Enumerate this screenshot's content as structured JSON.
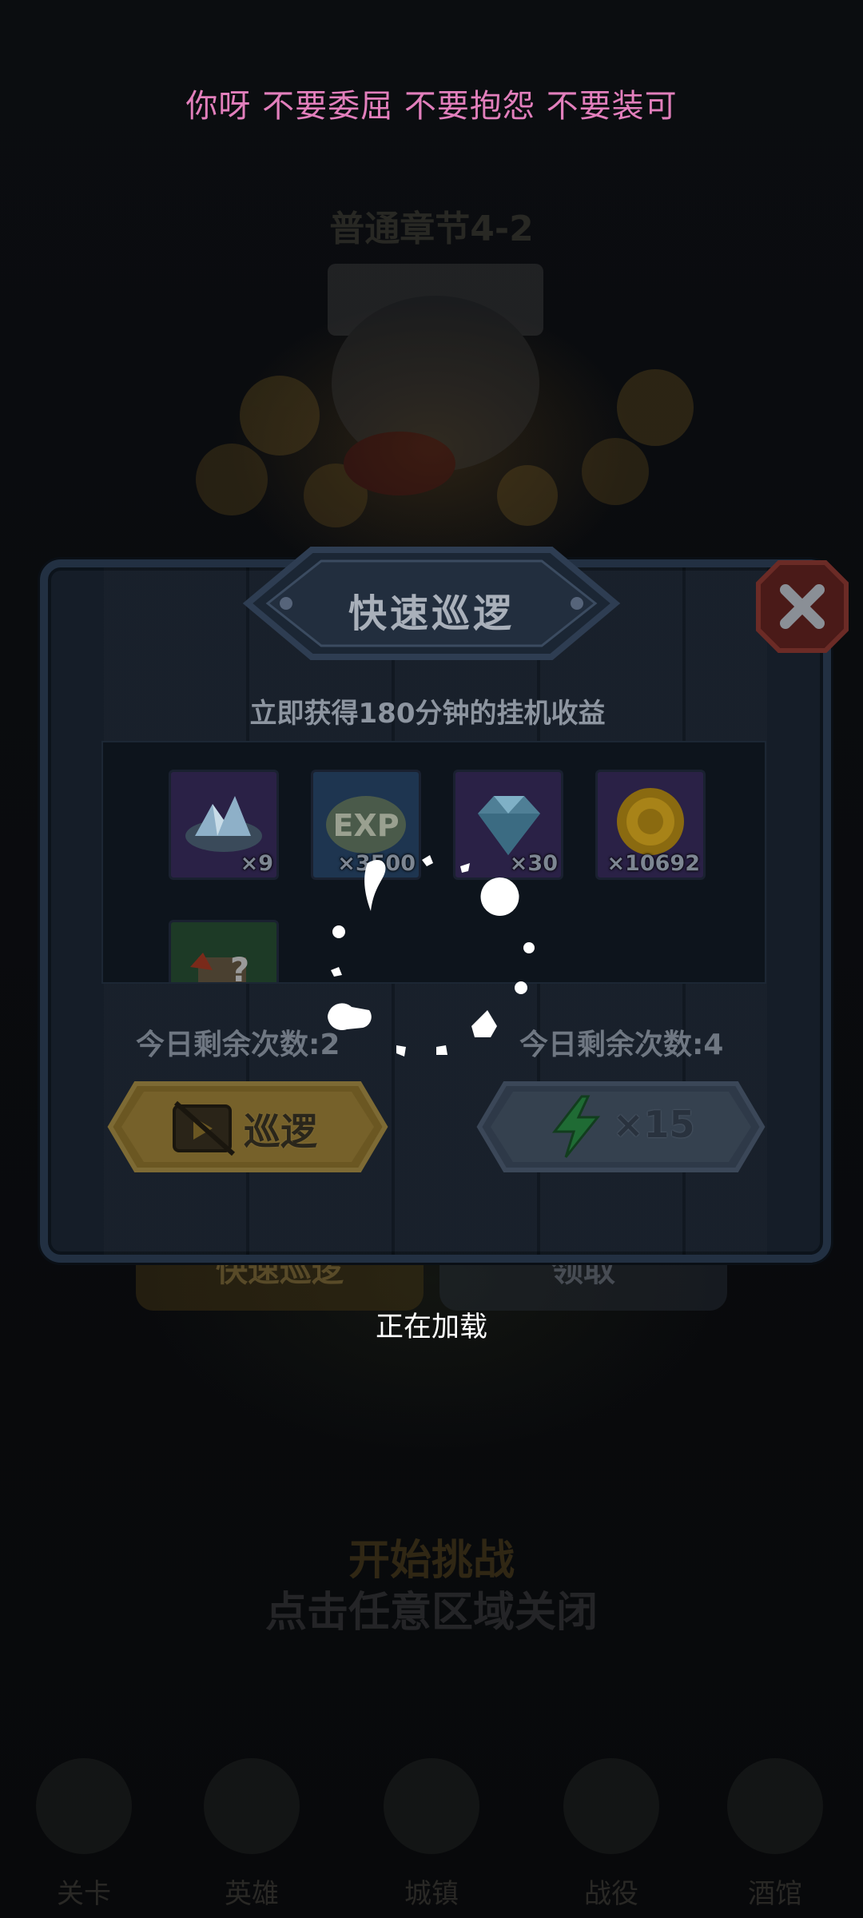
{
  "scrolling_text": "你呀 不要委屈 不要抱怨 不要装可",
  "background": {
    "stage_title": "普通章节4-2",
    "hint_start": "开始挑战",
    "tap_to_close": "点击任意区域关闭",
    "behind_buttons": {
      "quick_patrol": "快速巡逻",
      "claim": "领取"
    },
    "nav": [
      "关卡",
      "英雄",
      "城镇",
      "战役",
      "酒馆"
    ]
  },
  "dialog": {
    "title": "快速巡逻",
    "subtitle": "立即获得180分钟的挂机收益",
    "rewards": [
      {
        "icon": "ice-crystal-icon",
        "count": "×9",
        "color": "#2a2146"
      },
      {
        "icon": "exp-icon",
        "count": "×3500",
        "color": "#1e3550"
      },
      {
        "icon": "diamond-icon",
        "count": "×30",
        "color": "#2a2146"
      },
      {
        "icon": "gold-coin-icon",
        "count": "×10692",
        "color": "#2a2146"
      },
      {
        "icon": "mystery-box-icon",
        "count": "",
        "color": "#1d3a26"
      }
    ],
    "left_remaining": "今日剩余次数:2",
    "right_remaining": "今日剩余次数:4",
    "patrol_button": "巡逻",
    "energy_button": "×15"
  },
  "loading": {
    "text": "正在加载"
  }
}
